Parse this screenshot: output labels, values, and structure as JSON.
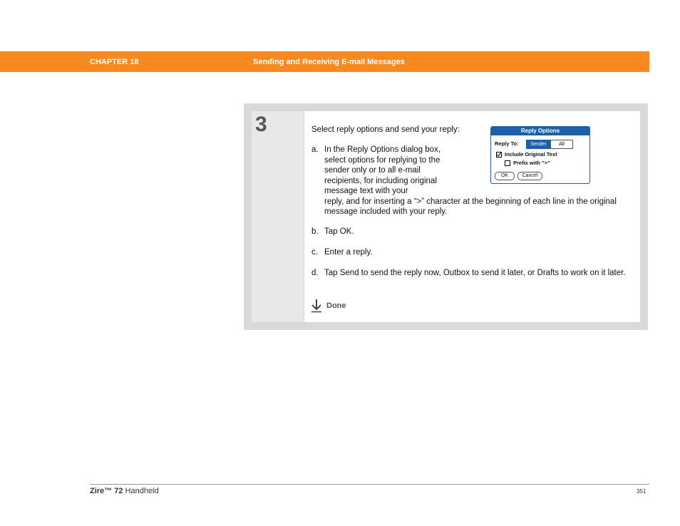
{
  "header": {
    "chapter": "CHAPTER 18",
    "title": "Sending and Receiving E-mail Messages",
    "bar_color": "#f7891f"
  },
  "step": {
    "number": "3",
    "intro": "Select reply options and send your reply:",
    "items": [
      {
        "letter": "a.",
        "text_narrow": "In the Reply Options dialog box, select options for replying to the sender only or to all e-mail recipients, for including original message text with your",
        "text_wide": "reply, and for inserting a “>” character at the beginning of each line in the original message included with your reply."
      },
      {
        "letter": "b.",
        "text": "Tap OK."
      },
      {
        "letter": "c.",
        "text": "Enter a reply."
      },
      {
        "letter": "d.",
        "text": "Tap Send to send the reply now, Outbox to send it later, or Drafts to work on it later."
      }
    ],
    "done_label": "Done",
    "done_icon": "down-arrow-icon"
  },
  "dialog": {
    "title": "Reply Options",
    "reply_to_label": "Reply To:",
    "sender_label": "Sender",
    "all_label": "All",
    "include_original_label": "Include Original Text",
    "include_original_checked": true,
    "prefix_label": "Prefix with \">\"",
    "prefix_checked": false,
    "ok_label": "OK",
    "cancel_label": "Cancel",
    "accent_color": "#1f5fa8"
  },
  "footer": {
    "product_bold": "Zire™ 72",
    "product_rest": " Handheld",
    "page": "351"
  }
}
